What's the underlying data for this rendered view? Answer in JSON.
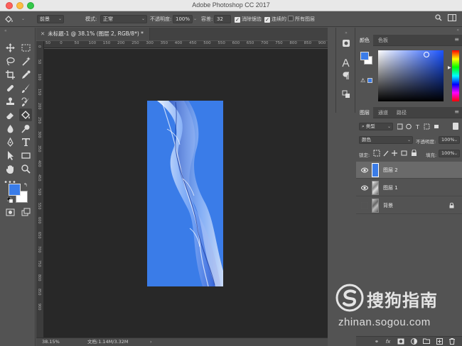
{
  "window": {
    "title": "Adobe Photoshop CC 2017"
  },
  "options_bar": {
    "tool_preset": "前景",
    "mode_label": "模式:",
    "mode_value": "正常",
    "opacity_label": "不透明度:",
    "opacity_value": "100%",
    "tolerance_label": "容差:",
    "tolerance_value": "32",
    "antialias_label": "消除锯齿",
    "antialias_checked": true,
    "contiguous_label": "连续的",
    "contiguous_checked": true,
    "all_layers_label": "所有图层",
    "all_layers_checked": false
  },
  "document": {
    "tab_title": "未标题-1 @ 38.1% (图层 2, RGB/8*) *",
    "ruler_labels": [
      "50",
      "0",
      "50",
      "100",
      "150",
      "200",
      "250",
      "300",
      "350",
      "400",
      "450",
      "500",
      "550",
      "600",
      "650",
      "700",
      "750",
      "800",
      "850",
      "900"
    ],
    "zoom": "38.15%",
    "doc_info": "文档:1.14M/3.32M",
    "fill_color": "#3a7ce8"
  },
  "panels": {
    "color_tabs": [
      "颜色",
      "色板"
    ],
    "layers_tabs": [
      "图层",
      "通道",
      "路径"
    ],
    "filter_kind": "类型",
    "blend_mode": "颜色",
    "opacity_label": "不透明度:",
    "opacity_value": "100%",
    "lock_label": "锁定:",
    "fill_label": "填充:",
    "fill_value": "100%",
    "layers": [
      {
        "name": "图层 2",
        "visible": true,
        "selected": true
      },
      {
        "name": "图层 1",
        "visible": true,
        "selected": false
      },
      {
        "name": "背景",
        "visible": false,
        "selected": false,
        "locked": true
      }
    ]
  },
  "swatches": {
    "foreground": "#3a7ce8",
    "background": "#ffffff"
  },
  "watermark": {
    "brand": "搜狗指南",
    "url": "zhinan.sogou.com"
  }
}
